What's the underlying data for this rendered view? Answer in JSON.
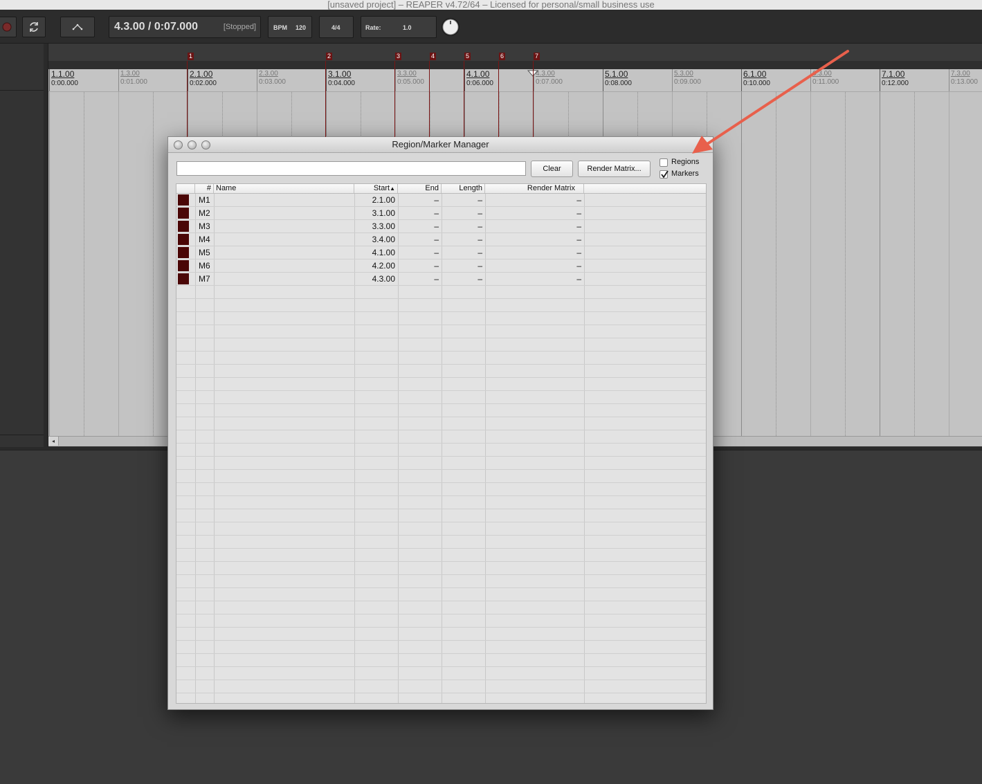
{
  "window": {
    "title": "[unsaved project] – REAPER v4.72/64 – Licensed for personal/small business use"
  },
  "transport": {
    "time": "4.3.00 / 0:07.000",
    "state": "[Stopped]",
    "bpm_label": "BPM",
    "bpm_value": "120",
    "time_sig": "4/4",
    "rate_label": "Rate:",
    "rate_value": "1.0",
    "icons": [
      "record-icon",
      "loop-icon",
      "envelope-icon",
      "knob-icon"
    ]
  },
  "ruler": {
    "ticks": [
      {
        "bar": "1.1.00",
        "time": "0:00.000",
        "major": true
      },
      {
        "bar": "1.3.00",
        "time": "0:01.000",
        "major": false
      },
      {
        "bar": "2.1.00",
        "time": "0:02.000",
        "major": true
      },
      {
        "bar": "2.3.00",
        "time": "0:03.000",
        "major": false
      },
      {
        "bar": "3.1.00",
        "time": "0:04.000",
        "major": true
      },
      {
        "bar": "3.3.00",
        "time": "0:05.000",
        "major": false
      },
      {
        "bar": "4.1.00",
        "time": "0:06.000",
        "major": true
      },
      {
        "bar": "4.3.00",
        "time": "0:07.000",
        "major": false
      },
      {
        "bar": "5.1.00",
        "time": "0:08.000",
        "major": true
      },
      {
        "bar": "5.3.00",
        "time": "0:09.000",
        "major": false
      },
      {
        "bar": "6.1.00",
        "time": "0:10.000",
        "major": true
      },
      {
        "bar": "6.3.00",
        "time": "0:11.000",
        "major": false
      },
      {
        "bar": "7.1.00",
        "time": "0:12.000",
        "major": true
      },
      {
        "bar": "7.3.00",
        "time": "0:13.000",
        "major": false
      }
    ],
    "markers": [
      "1",
      "2",
      "3",
      "4",
      "5",
      "6",
      "7"
    ]
  },
  "dialog": {
    "title": "Region/Marker Manager",
    "filter_value": "",
    "clear_label": "Clear",
    "render_matrix_label": "Render Matrix...",
    "regions_label": "Regions",
    "regions_checked": false,
    "markers_label": "Markers",
    "markers_checked": true,
    "columns": {
      "num": "#",
      "name": "Name",
      "start": "Start",
      "end": "End",
      "length": "Length",
      "render": "Render Matrix"
    },
    "sort_indicator": "▲",
    "rows": [
      {
        "id": "M1",
        "name": "",
        "start": "2.1.00",
        "end": "–",
        "length": "–",
        "render": "–",
        "color": "#4a0606"
      },
      {
        "id": "M2",
        "name": "",
        "start": "3.1.00",
        "end": "–",
        "length": "–",
        "render": "–",
        "color": "#4a0606"
      },
      {
        "id": "M3",
        "name": "",
        "start": "3.3.00",
        "end": "–",
        "length": "–",
        "render": "–",
        "color": "#4a0606"
      },
      {
        "id": "M4",
        "name": "",
        "start": "3.4.00",
        "end": "–",
        "length": "–",
        "render": "–",
        "color": "#4a0606"
      },
      {
        "id": "M5",
        "name": "",
        "start": "4.1.00",
        "end": "–",
        "length": "–",
        "render": "–",
        "color": "#4a0606"
      },
      {
        "id": "M6",
        "name": "",
        "start": "4.2.00",
        "end": "–",
        "length": "–",
        "render": "–",
        "color": "#4a0606"
      },
      {
        "id": "M7",
        "name": "",
        "start": "4.3.00",
        "end": "–",
        "length": "–",
        "render": "–",
        "color": "#4a0606"
      }
    ]
  },
  "colors": {
    "marker": "#6b1414",
    "swatch": "#4a0606",
    "annotation_arrow": "#e8604c"
  }
}
